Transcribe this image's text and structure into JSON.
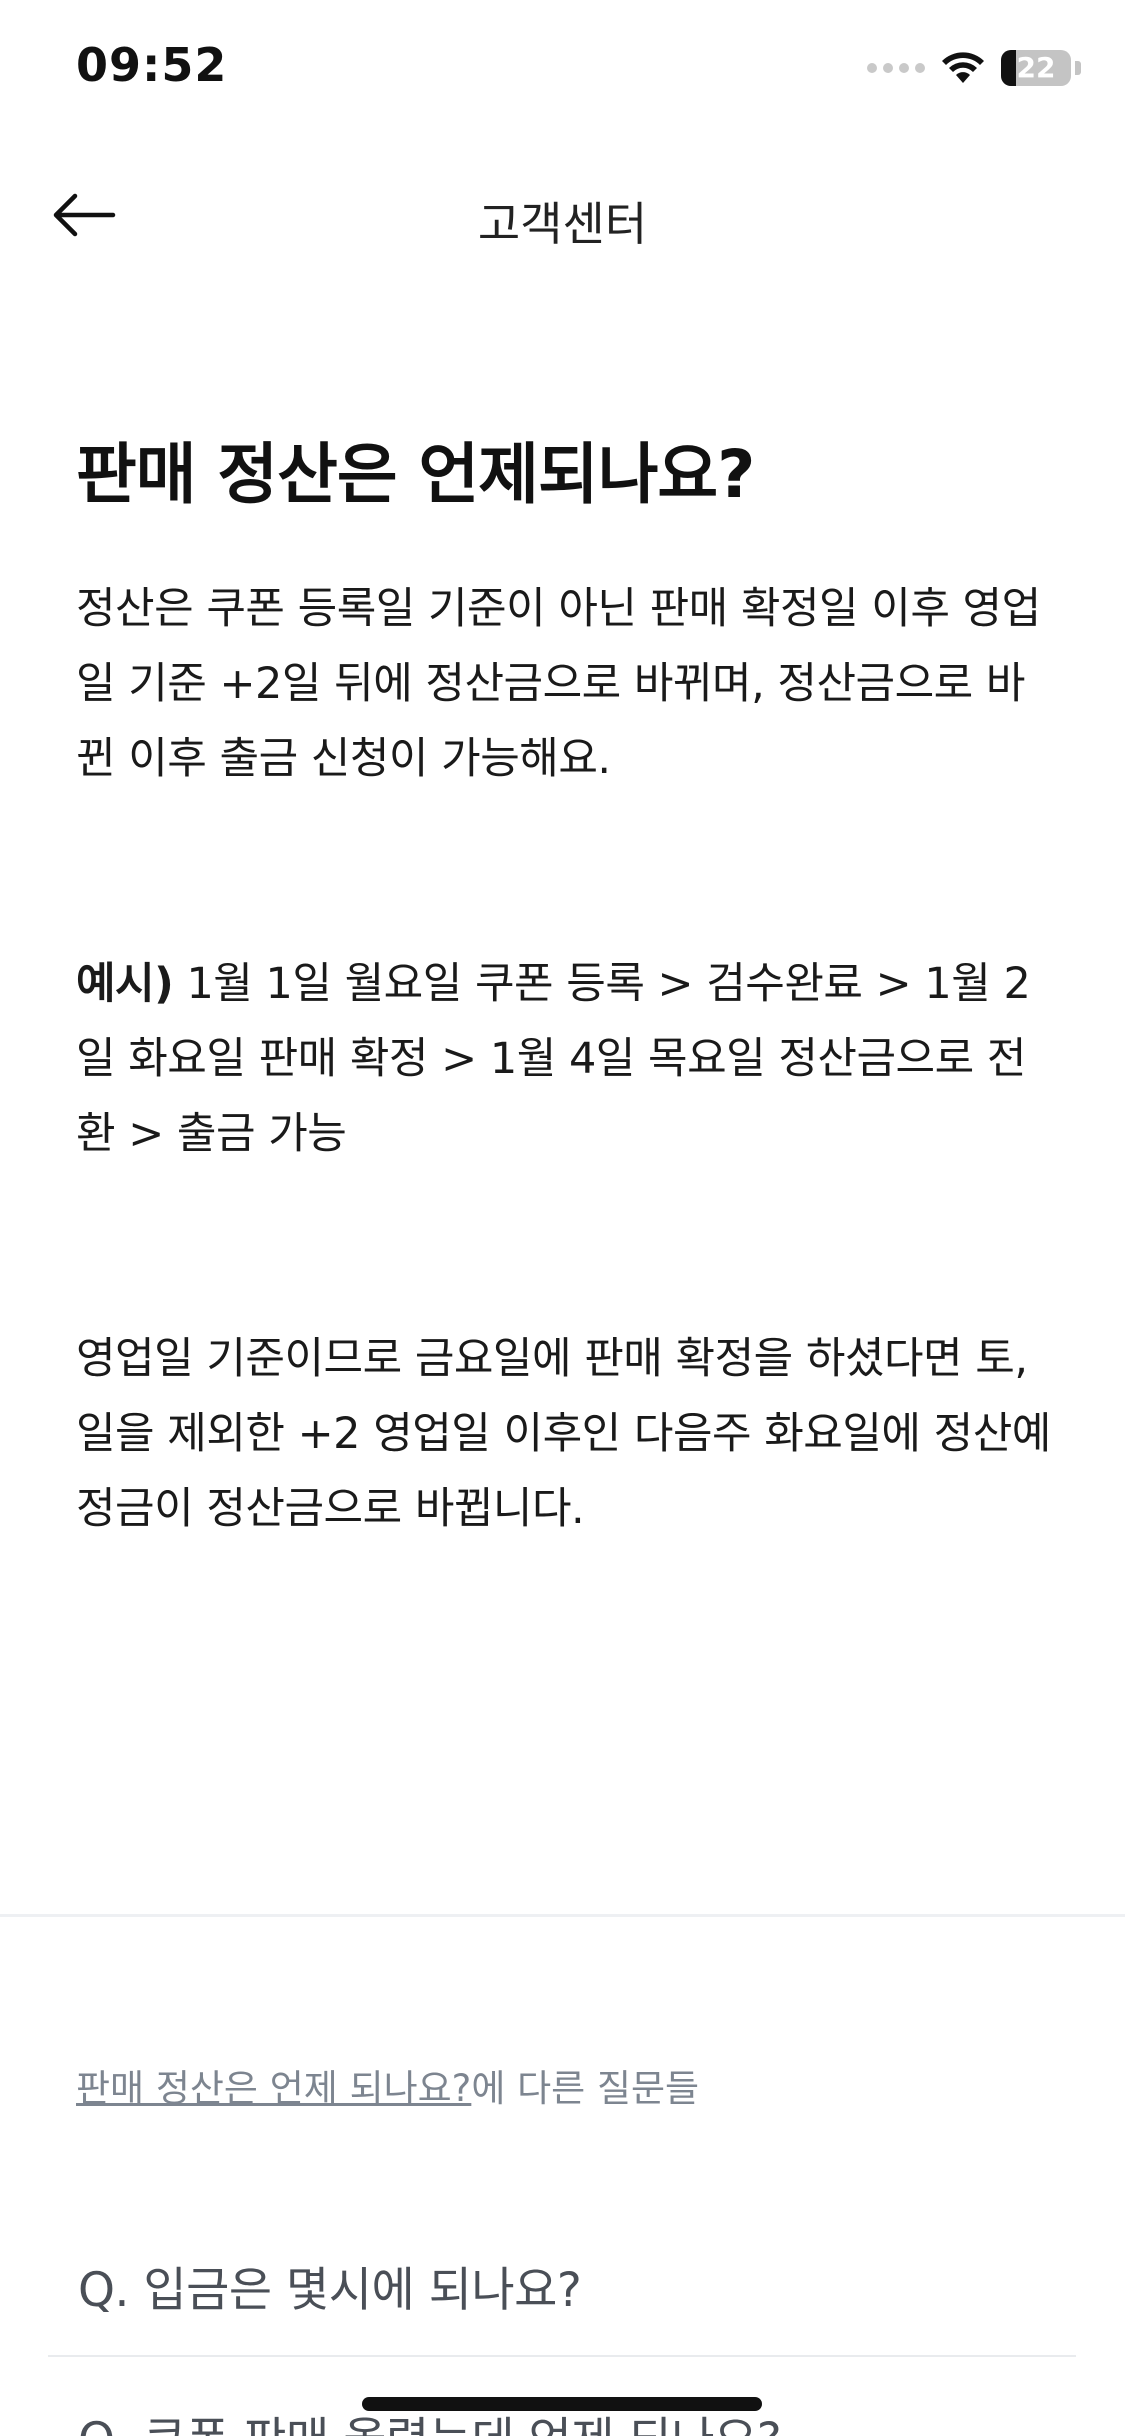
{
  "status_bar": {
    "time": "09:52",
    "battery_level": "22",
    "battery_fraction": 0.22,
    "icons": [
      "signal-dots-icon",
      "wifi-icon",
      "battery-icon"
    ]
  },
  "nav": {
    "title": "고객센터",
    "back_icon": "arrow-left-icon"
  },
  "article": {
    "title": "판매 정산은 언제되나요?",
    "paragraph_1": "정산은 쿠폰 등록일 기준이 아닌 판매 확정일 이후 영업일 기준 +2일 뒤에 정산금으로 바뀌며, 정산금으로 바뀐 이후 출금 신청이 가능해요.",
    "example_label": "예시)",
    "example_text": " 1월 1일 월요일 쿠폰 등록 > 검수완료 > 1월 2일 화요일 판매 확정 > 1월 4일 목요일 정산금으로 전환 > 출금 가능",
    "paragraph_3": "영업일 기준이므로 금요일에 판매 확정을 하셨다면 토,일을 제외한 +2 영업일 이후인 다음주 화요일에 정산예정금이 정산금으로 바뀝니다."
  },
  "related": {
    "link_text": "판매 정산은 언제 되나요?",
    "suffix": "에 다른 질문들",
    "items": [
      {
        "label": "Q. 입금은 몇시에 되나요?"
      },
      {
        "label": "Q. 쿠폰 판매 올렸는데 언제 되나요?"
      }
    ]
  },
  "colors": {
    "text_primary": "#111111",
    "text_secondary": "#7d8590",
    "faq_text": "#4a4f57",
    "divider": "#eef0f3"
  }
}
